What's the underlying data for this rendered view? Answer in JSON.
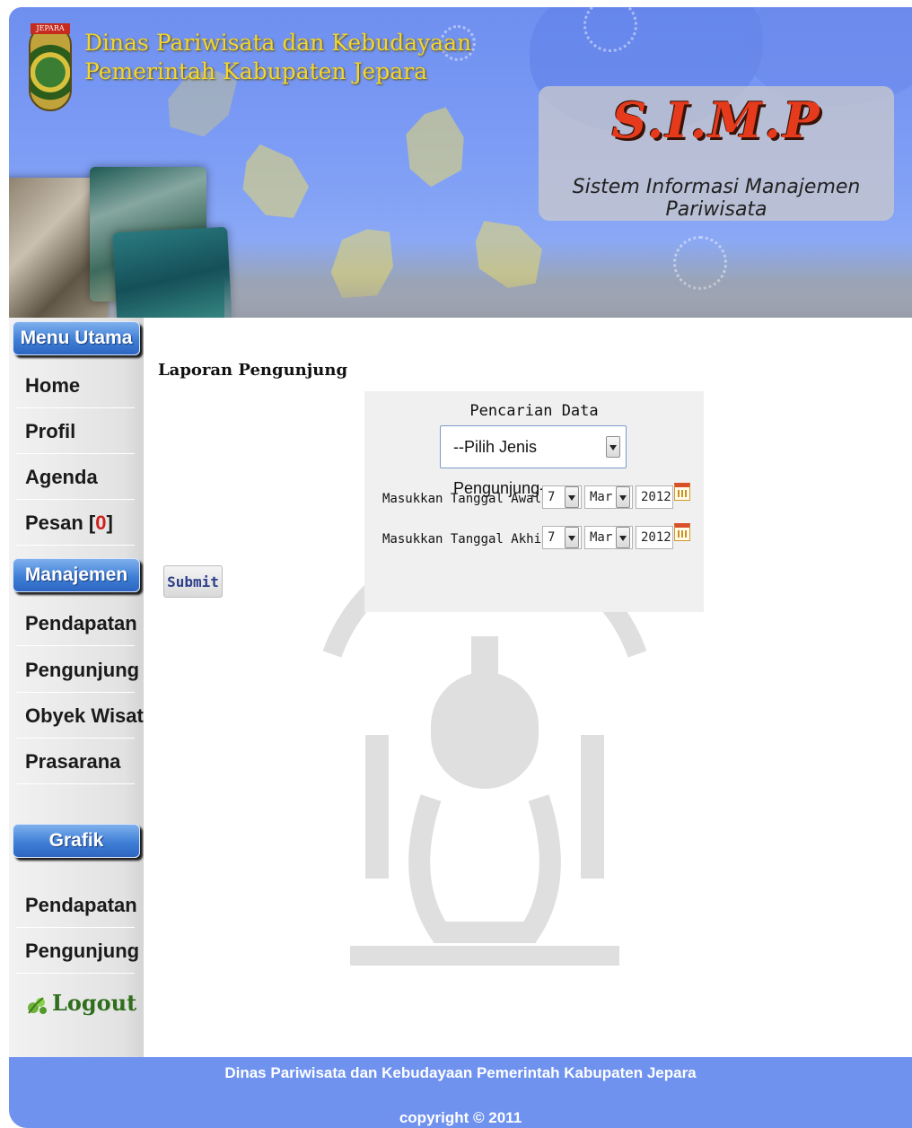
{
  "header": {
    "emblem_label": "JEPARA",
    "org_line1": "Dinas Pariwisata dan Kebudayaan",
    "org_line2": "Pemerintah Kabupaten Jepara",
    "app_title": "S.I.M.P",
    "app_subtitle": "Sistem Informasi Manajemen Pariwisata"
  },
  "sidebar": {
    "sections": [
      {
        "title": "Menu Utama"
      },
      {
        "title": "Manajemen"
      },
      {
        "title": "Grafik"
      }
    ],
    "main_items": [
      {
        "label": "Home"
      },
      {
        "label": "Profil"
      },
      {
        "label": "Agenda"
      },
      {
        "label": "Pesan [",
        "count": "0",
        "suffix": "]"
      }
    ],
    "manage_items": [
      {
        "label": "Pendapatan"
      },
      {
        "label": "Pengunjung"
      },
      {
        "label": "Obyek Wisata"
      },
      {
        "label": "Prasarana"
      }
    ],
    "chart_items": [
      {
        "label": "Pendapatan"
      },
      {
        "label": "Pengunjung"
      }
    ],
    "logout_label": "Logout"
  },
  "main": {
    "heading": "Laporan Pengunjung",
    "search": {
      "title": "Pencarian Data",
      "type_select_value": "--Pilih Jenis Pengunjung--",
      "start_label": "Masukkan Tanggal Awal",
      "end_label": "Masukkan Tanggal Akhir",
      "start_day": "7",
      "start_month": "Mar",
      "start_year": "2012",
      "end_day": "7",
      "end_month": "Mar",
      "end_year": "2012",
      "submit_label": "Submit"
    }
  },
  "footer": {
    "line1": "Dinas Pariwisata dan Kebudayaan Pemerintah Kabupaten Jepara",
    "line2": "copyright © 2011"
  },
  "colors": {
    "header_blue": "#7c9cf5",
    "menu_head_blue": "#3f7fd6",
    "footer_blue": "#6f92ef",
    "title_gold": "#f2d630",
    "simp_red": "#e63a1c",
    "message_count_red": "#d0201c"
  }
}
